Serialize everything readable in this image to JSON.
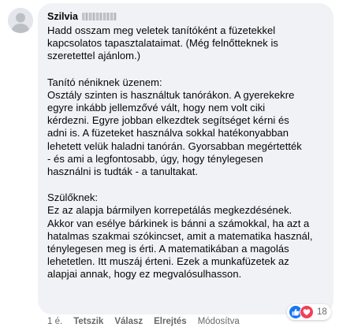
{
  "comment": {
    "author": "Szilvia",
    "paragraphs": [
      "Hadd osszam meg veletek tanítóként a füzetekkel\nkapcsolatos tapasztalataimat. (Még felnőtteknek is\nszeretettel ajánlom.)",
      "Tanító néniknek üzenem:\nOsztály szinten is használtuk tanórákon. A gyerekekre\negyre inkább jellemzővé vált, hogy nem volt ciki\nkérdezni. Egyre jobban elkezdtek segítséget kérni és\nadni is. A füzeteket használva sokkal hatékonyabban\nlehetett velük haladni tanórán. Gyorsabban megértették\n- és ami a legfontosabb, úgy, hogy ténylegesen\nhasználni is tudták - a tanultakat.",
      "Szülőknek:\nEz az alapja bármilyen korrepetálás megkezdésének.\nAkkor van esélye bárkinek is bánni a számokkal, ha azt a\nhatalmas szakmai szókincset, amit a matematika használ,\nténylegesen meg is érti. A matematikában a magolás\nlehetetlen. Itt muszáj érteni. Ezek a munkafüzetek az\nalapjai annak, hogy ez megvalósulhasson."
    ]
  },
  "actions": {
    "time": "1 é.",
    "like": "Tetszik",
    "reply": "Válasz",
    "hide": "Elrejtés",
    "edited": "Módosítva"
  },
  "reactions": {
    "icons": [
      "like-icon",
      "love-icon"
    ],
    "count": "18",
    "colors": {
      "like": "#1877f2",
      "love": "#f33e58"
    }
  }
}
